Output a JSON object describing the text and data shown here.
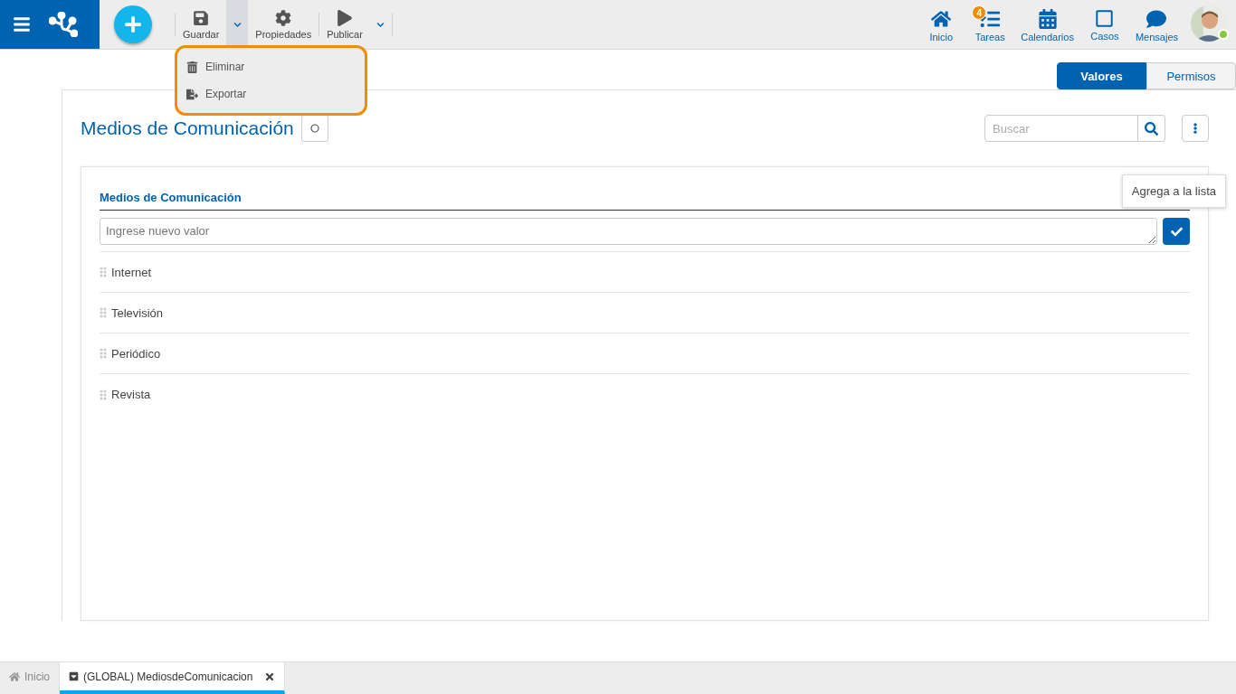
{
  "toolbar": {
    "actions": [
      {
        "kind": "save",
        "label": "Guardar"
      },
      {
        "kind": "caret",
        "expanded": true
      },
      {
        "kind": "settings",
        "label": "Propiedades"
      },
      {
        "kind": "publish",
        "label": "Publicar"
      },
      {
        "kind": "caret",
        "expanded": false
      }
    ],
    "menu": [
      {
        "kind": "delete",
        "label": "Eliminar"
      },
      {
        "kind": "export",
        "label": "Exportar"
      }
    ]
  },
  "nav": [
    {
      "kind": "home",
      "label": "Inicio"
    },
    {
      "kind": "tasks",
      "label": "Tareas",
      "badge": "4"
    },
    {
      "kind": "calendar",
      "label": "Calendarios"
    },
    {
      "kind": "cases",
      "label": "Casos"
    },
    {
      "kind": "messages",
      "label": "Mensajes"
    }
  ],
  "user": {
    "online": true
  },
  "view_tabs": [
    {
      "label": "Valores",
      "selected": true
    },
    {
      "label": "Permisos",
      "selected": false
    }
  ],
  "title": "Medios de Comunicación",
  "search": {
    "placeholder": "Buscar"
  },
  "list": {
    "heading": "Medios de Comunicación",
    "input": {
      "placeholder": "Ingrese nuevo valor"
    },
    "tooltip": "Agrega a la lista",
    "items": [
      "Internet",
      "Televisión",
      "Periódico",
      "Revista"
    ]
  },
  "bottom_tabs": [
    {
      "kind": "home",
      "label": "Inicio",
      "selected": false
    },
    {
      "kind": "document",
      "label": "(GLOBAL) MediosdeComunicacion",
      "selected": true,
      "closable": true
    }
  ]
}
